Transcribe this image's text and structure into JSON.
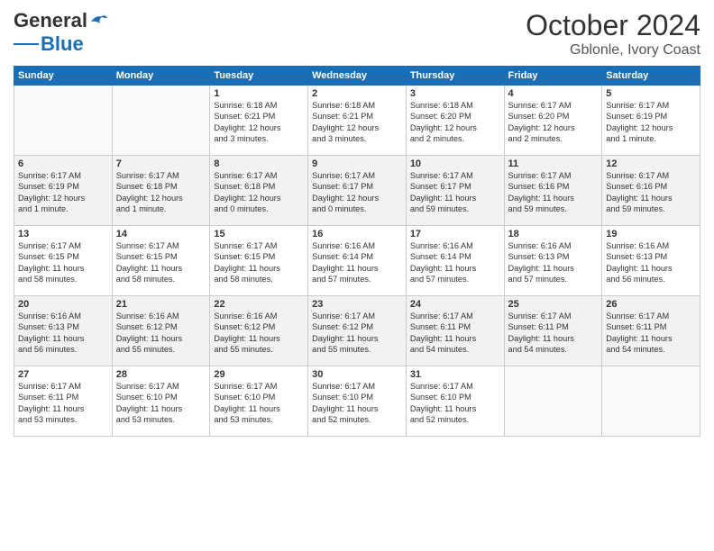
{
  "header": {
    "logo_line1": "General",
    "logo_line2": "Blue",
    "month": "October 2024",
    "location": "Gblonle, Ivory Coast"
  },
  "weekdays": [
    "Sunday",
    "Monday",
    "Tuesday",
    "Wednesday",
    "Thursday",
    "Friday",
    "Saturday"
  ],
  "weeks": [
    [
      {
        "day": "",
        "info": ""
      },
      {
        "day": "",
        "info": ""
      },
      {
        "day": "1",
        "info": "Sunrise: 6:18 AM\nSunset: 6:21 PM\nDaylight: 12 hours\nand 3 minutes."
      },
      {
        "day": "2",
        "info": "Sunrise: 6:18 AM\nSunset: 6:21 PM\nDaylight: 12 hours\nand 3 minutes."
      },
      {
        "day": "3",
        "info": "Sunrise: 6:18 AM\nSunset: 6:20 PM\nDaylight: 12 hours\nand 2 minutes."
      },
      {
        "day": "4",
        "info": "Sunrise: 6:17 AM\nSunset: 6:20 PM\nDaylight: 12 hours\nand 2 minutes."
      },
      {
        "day": "5",
        "info": "Sunrise: 6:17 AM\nSunset: 6:19 PM\nDaylight: 12 hours\nand 1 minute."
      }
    ],
    [
      {
        "day": "6",
        "info": "Sunrise: 6:17 AM\nSunset: 6:19 PM\nDaylight: 12 hours\nand 1 minute."
      },
      {
        "day": "7",
        "info": "Sunrise: 6:17 AM\nSunset: 6:18 PM\nDaylight: 12 hours\nand 1 minute."
      },
      {
        "day": "8",
        "info": "Sunrise: 6:17 AM\nSunset: 6:18 PM\nDaylight: 12 hours\nand 0 minutes."
      },
      {
        "day": "9",
        "info": "Sunrise: 6:17 AM\nSunset: 6:17 PM\nDaylight: 12 hours\nand 0 minutes."
      },
      {
        "day": "10",
        "info": "Sunrise: 6:17 AM\nSunset: 6:17 PM\nDaylight: 11 hours\nand 59 minutes."
      },
      {
        "day": "11",
        "info": "Sunrise: 6:17 AM\nSunset: 6:16 PM\nDaylight: 11 hours\nand 59 minutes."
      },
      {
        "day": "12",
        "info": "Sunrise: 6:17 AM\nSunset: 6:16 PM\nDaylight: 11 hours\nand 59 minutes."
      }
    ],
    [
      {
        "day": "13",
        "info": "Sunrise: 6:17 AM\nSunset: 6:15 PM\nDaylight: 11 hours\nand 58 minutes."
      },
      {
        "day": "14",
        "info": "Sunrise: 6:17 AM\nSunset: 6:15 PM\nDaylight: 11 hours\nand 58 minutes."
      },
      {
        "day": "15",
        "info": "Sunrise: 6:17 AM\nSunset: 6:15 PM\nDaylight: 11 hours\nand 58 minutes."
      },
      {
        "day": "16",
        "info": "Sunrise: 6:16 AM\nSunset: 6:14 PM\nDaylight: 11 hours\nand 57 minutes."
      },
      {
        "day": "17",
        "info": "Sunrise: 6:16 AM\nSunset: 6:14 PM\nDaylight: 11 hours\nand 57 minutes."
      },
      {
        "day": "18",
        "info": "Sunrise: 6:16 AM\nSunset: 6:13 PM\nDaylight: 11 hours\nand 57 minutes."
      },
      {
        "day": "19",
        "info": "Sunrise: 6:16 AM\nSunset: 6:13 PM\nDaylight: 11 hours\nand 56 minutes."
      }
    ],
    [
      {
        "day": "20",
        "info": "Sunrise: 6:16 AM\nSunset: 6:13 PM\nDaylight: 11 hours\nand 56 minutes."
      },
      {
        "day": "21",
        "info": "Sunrise: 6:16 AM\nSunset: 6:12 PM\nDaylight: 11 hours\nand 55 minutes."
      },
      {
        "day": "22",
        "info": "Sunrise: 6:16 AM\nSunset: 6:12 PM\nDaylight: 11 hours\nand 55 minutes."
      },
      {
        "day": "23",
        "info": "Sunrise: 6:17 AM\nSunset: 6:12 PM\nDaylight: 11 hours\nand 55 minutes."
      },
      {
        "day": "24",
        "info": "Sunrise: 6:17 AM\nSunset: 6:11 PM\nDaylight: 11 hours\nand 54 minutes."
      },
      {
        "day": "25",
        "info": "Sunrise: 6:17 AM\nSunset: 6:11 PM\nDaylight: 11 hours\nand 54 minutes."
      },
      {
        "day": "26",
        "info": "Sunrise: 6:17 AM\nSunset: 6:11 PM\nDaylight: 11 hours\nand 54 minutes."
      }
    ],
    [
      {
        "day": "27",
        "info": "Sunrise: 6:17 AM\nSunset: 6:11 PM\nDaylight: 11 hours\nand 53 minutes."
      },
      {
        "day": "28",
        "info": "Sunrise: 6:17 AM\nSunset: 6:10 PM\nDaylight: 11 hours\nand 53 minutes."
      },
      {
        "day": "29",
        "info": "Sunrise: 6:17 AM\nSunset: 6:10 PM\nDaylight: 11 hours\nand 53 minutes."
      },
      {
        "day": "30",
        "info": "Sunrise: 6:17 AM\nSunset: 6:10 PM\nDaylight: 11 hours\nand 52 minutes."
      },
      {
        "day": "31",
        "info": "Sunrise: 6:17 AM\nSunset: 6:10 PM\nDaylight: 11 hours\nand 52 minutes."
      },
      {
        "day": "",
        "info": ""
      },
      {
        "day": "",
        "info": ""
      }
    ]
  ]
}
